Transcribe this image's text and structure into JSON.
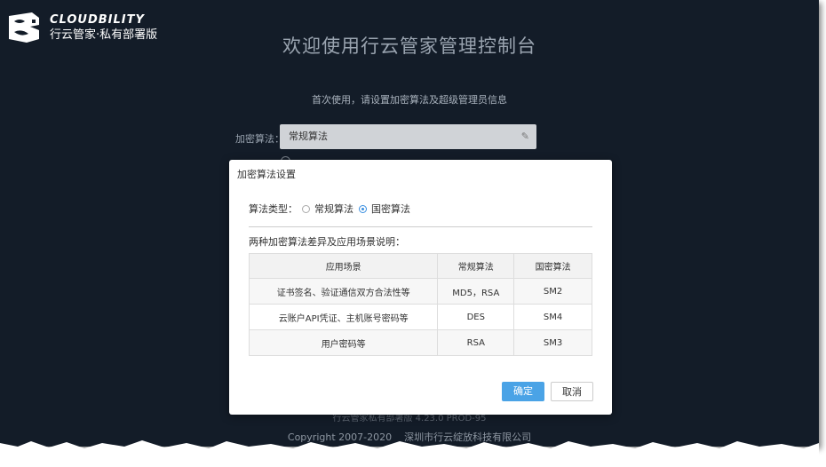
{
  "brand": {
    "en": "CLOUDBILITY",
    "cn": "行云管家·私有部署版"
  },
  "page": {
    "title": "欢迎使用行云管家管理控制台",
    "subtitle": "首次使用，请设置加密算法及超级管理员信息",
    "algo_label": "加密算法：",
    "algo_value": "常规算法"
  },
  "footer": {
    "version": "行云管家私有部署版 4.23.0 PROD-95",
    "copyright": "Copyright 2007-2020",
    "company": "深圳市行云绽放科技有限公司"
  },
  "modal": {
    "title": "加密算法设置",
    "type_label": "算法类型：",
    "options": [
      {
        "label": "常规算法",
        "checked": false
      },
      {
        "label": "国密算法",
        "checked": true
      }
    ],
    "explain": "两种加密算法差异及应用场景说明：",
    "table": {
      "headers": [
        "应用场景",
        "常规算法",
        "国密算法"
      ],
      "rows": [
        [
          "证书签名、验证通信双方合法性等",
          "MD5，RSA",
          "SM2"
        ],
        [
          "云账户API凭证、主机账号密码等",
          "DES",
          "SM4"
        ],
        [
          "用户密码等",
          "RSA",
          "SM3"
        ]
      ]
    },
    "ok_label": "确定",
    "cancel_label": "取消"
  },
  "colors": {
    "background": "#131c28",
    "primary": "#4aa3e6"
  },
  "icons": {
    "logo": "cloudbility-logo-icon",
    "edit": "pencil-icon"
  }
}
